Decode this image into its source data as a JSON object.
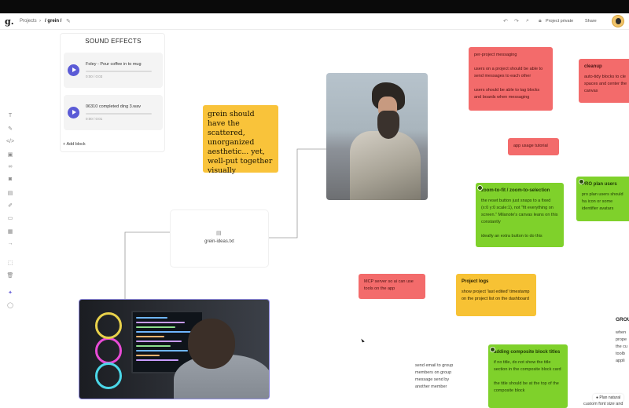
{
  "topbar": {
    "logo": "g.",
    "breadcrumb_root": "Projects",
    "breadcrumb_sep": "›",
    "breadcrumb_current": "/ grein /",
    "edit_icon": "pencil-icon",
    "undo_icon": "undo-icon",
    "redo_icon": "redo-icon",
    "search_icon": "search-icon",
    "privacy_label": "Project private",
    "share_label": "Share"
  },
  "left_toolbar": {
    "icons": [
      "text-icon",
      "link-icon",
      "code-icon",
      "image-icon",
      "chain-icon",
      "camera-icon",
      "document-icon",
      "pen-icon",
      "folder-icon",
      "grid-icon",
      "arrow-icon",
      "frame-icon",
      "trash-icon",
      "sparkle-icon",
      "chat-icon"
    ]
  },
  "sound_panel": {
    "title": "SOUND EFFECTS",
    "tracks": [
      {
        "title": "Foley - Pour coffee in to mug",
        "time": "0:00 / 0:03"
      },
      {
        "title": "06310 completed ding 3.wav",
        "time": "0:00 / 0:01"
      }
    ],
    "add_block": "Add block"
  },
  "notes": {
    "serif_note": "grein should have the scattered, unorganized aesthetic... yet, well-put together visually",
    "messaging": {
      "title": "per-project messaging",
      "p1": "users on a project should be able to send messages to each other",
      "p2": "users should be able to tag blocks and boards when messaging"
    },
    "cleanup": {
      "title": "cleanup",
      "p1": "auto-tidy blocks to cle spaces and center the canvas"
    },
    "app_usage": "app usage tutorial",
    "zoom": {
      "title": "zoom-to-fit / zoom-to-selection",
      "p1": "the reset button just snaps to a fixed (x:0 y:0 scale:1), not \"fit everything on screen.\" Milanote's canvas leans on this constantly",
      "p2": "ideally an extra button to do this"
    },
    "pro_plan": {
      "title": "PRO plan users",
      "p1": "pro plan users should ha icon or some identifier avatars"
    },
    "mcp": "MCP server so ai can use tools on the app",
    "project_logs": {
      "title": "Project logs",
      "p1": "show project 'last edited' timestamp on the project list on the dashboard"
    },
    "composite": {
      "title": "adding composite block titles",
      "p1": "if no title, do not show the title section in the composite block card",
      "p2": "the title should be at the top of the composite block"
    },
    "email_text": "send email to group members on group message send by another member",
    "group_partial": {
      "title": "GROU",
      "lines": [
        "when",
        "prope",
        "the cu",
        "toolb",
        "appli"
      ]
    },
    "custom_font": "custom font size and"
  },
  "file_card": {
    "icon": "document-icon",
    "name": "grein-ideas.txt"
  },
  "badge": "Plan natural",
  "colors": {
    "red": "#f36b6b",
    "green": "#7fd12b",
    "yellow": "#f7c234",
    "accent": "#5b5bd6"
  }
}
